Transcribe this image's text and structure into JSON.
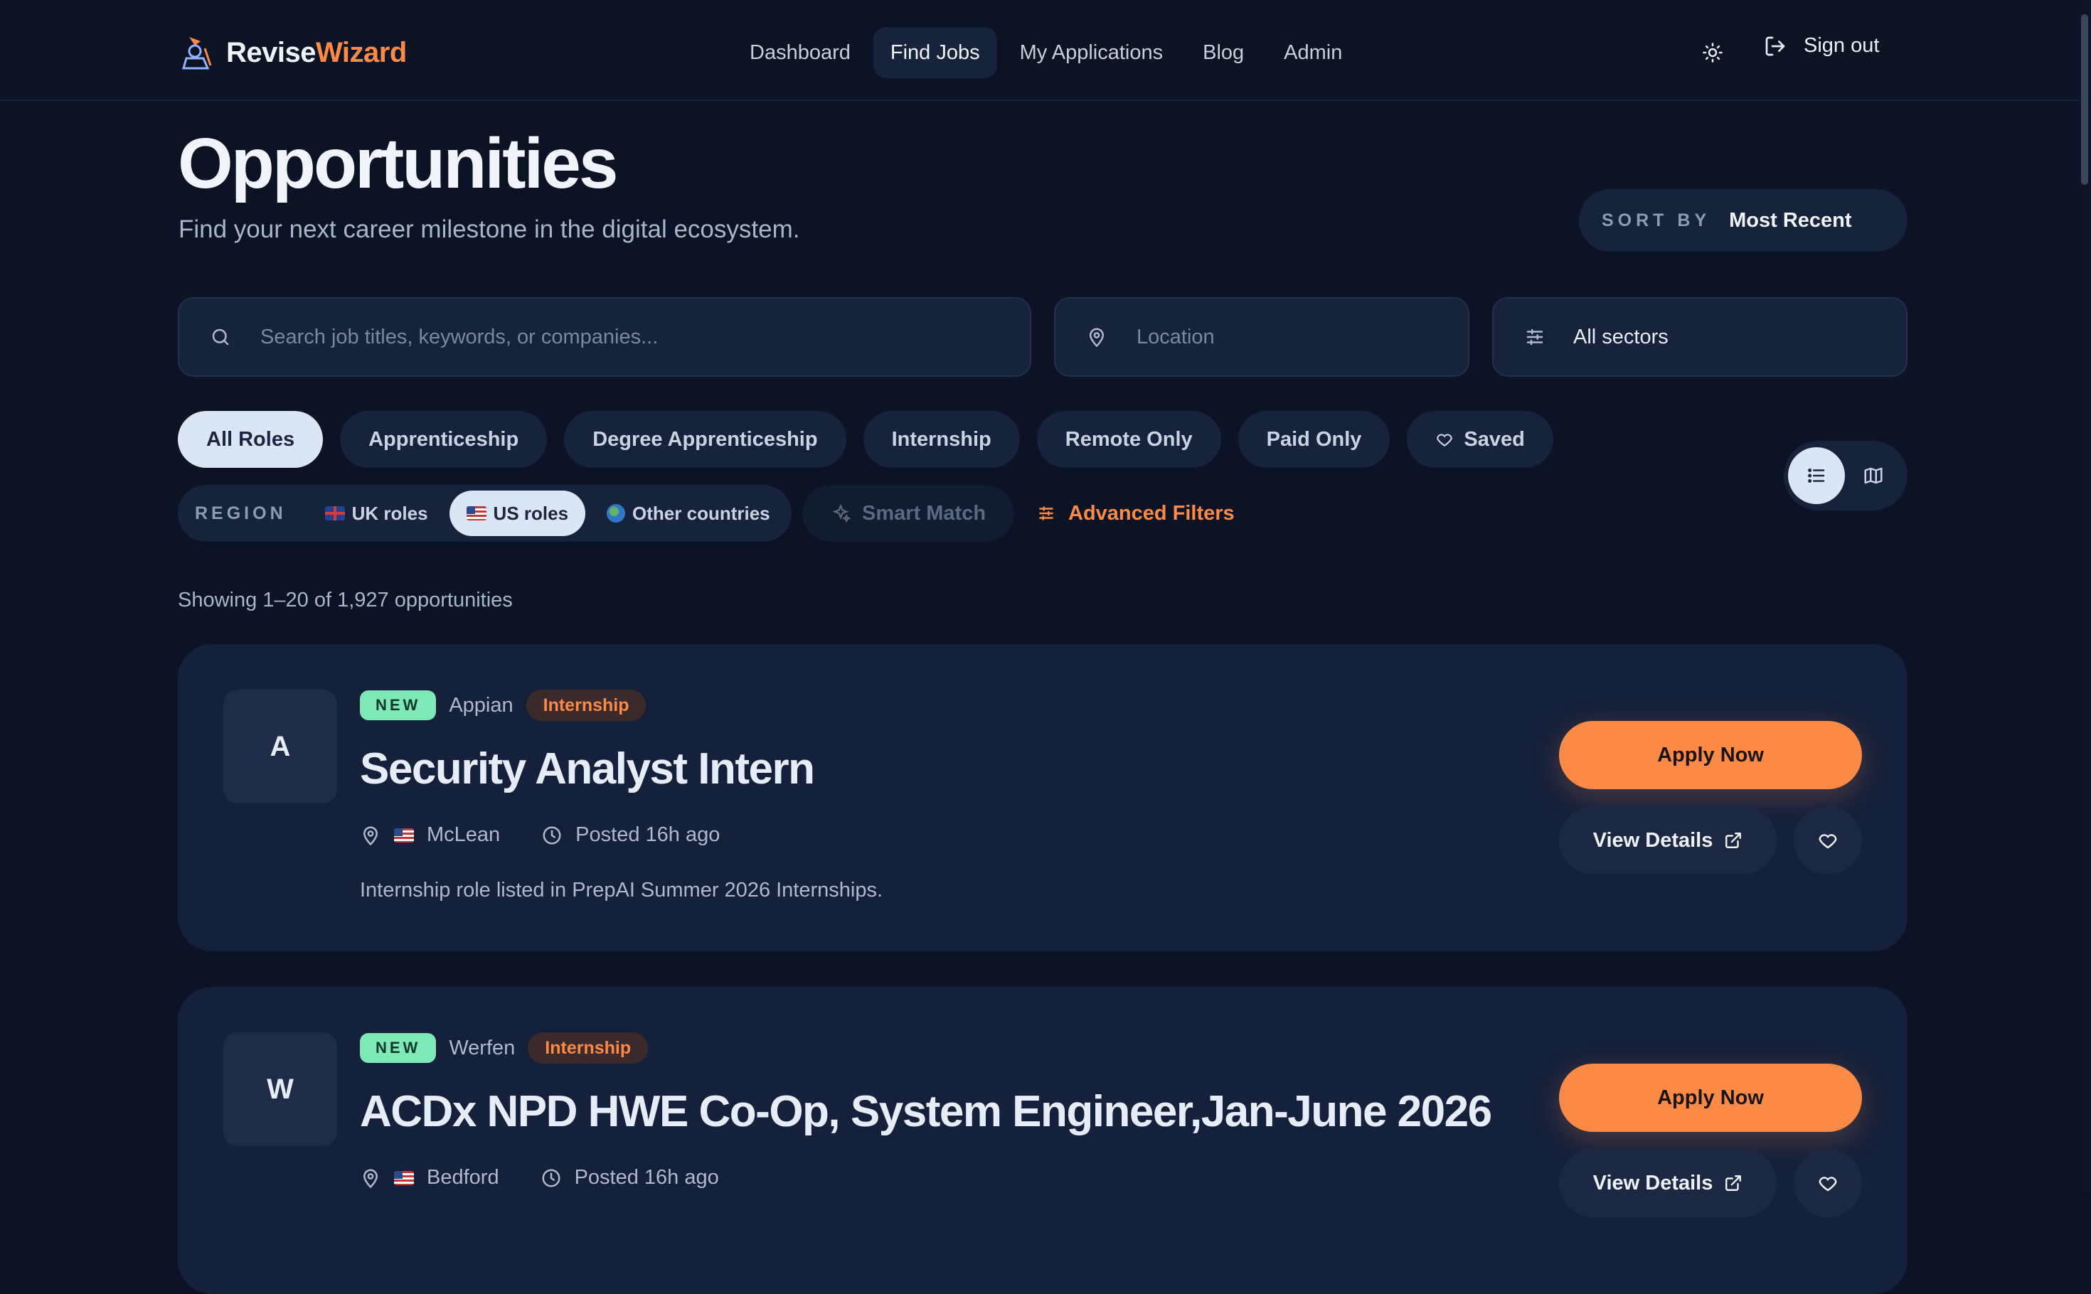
{
  "brand": {
    "name_part1": "Revise",
    "name_part2": "Wizard"
  },
  "nav": {
    "items": [
      {
        "label": "Dashboard"
      },
      {
        "label": "Find Jobs"
      },
      {
        "label": "My Applications"
      },
      {
        "label": "Blog"
      },
      {
        "label": "Admin"
      }
    ],
    "active": "Find Jobs",
    "theme_icon": "sun-icon",
    "signout_label": "Sign out"
  },
  "header": {
    "title": "Opportunities",
    "subtitle": "Find your next career milestone in the digital ecosystem.",
    "sort_label": "SORT BY",
    "sort_value": "Most Recent"
  },
  "search": {
    "keyword_placeholder": "Search job titles, keywords, or companies...",
    "location_placeholder": "Location",
    "sector_value": "All sectors"
  },
  "filters": {
    "chips": [
      {
        "label": "All Roles",
        "active": true
      },
      {
        "label": "Apprenticeship"
      },
      {
        "label": "Degree Apprenticeship"
      },
      {
        "label": "Internship"
      },
      {
        "label": "Remote Only"
      },
      {
        "label": "Paid Only"
      },
      {
        "label": "Saved"
      }
    ],
    "region_label": "REGION",
    "regions": [
      {
        "label": "UK roles"
      },
      {
        "label": "US roles",
        "active": true
      },
      {
        "label": "Other countries"
      }
    ],
    "smart_match_label": "Smart Match",
    "advanced_label": "Advanced Filters"
  },
  "results": {
    "count_text": "Showing 1–20 of 1,927 opportunities",
    "jobs": [
      {
        "initial": "A",
        "badge": "NEW",
        "company": "Appian",
        "type": "Internship",
        "title": "Security Analyst Intern",
        "location": "McLean",
        "posted": "Posted 16h ago",
        "description": "Internship role listed in PrepAI Summer 2026 Internships.",
        "apply_label": "Apply Now",
        "details_label": "View Details"
      },
      {
        "initial": "W",
        "badge": "NEW",
        "company": "Werfen",
        "type": "Internship",
        "title": "ACDx NPD HWE Co-Op, System Engineer,Jan-June 2026",
        "location": "Bedford",
        "posted": "Posted 16h ago",
        "apply_label": "Apply Now",
        "details_label": "View Details"
      }
    ]
  },
  "colors": {
    "background": "#0b1324",
    "card": "#15203a",
    "accent": "#fb8a46",
    "new_badge": "#7ee8b8"
  }
}
